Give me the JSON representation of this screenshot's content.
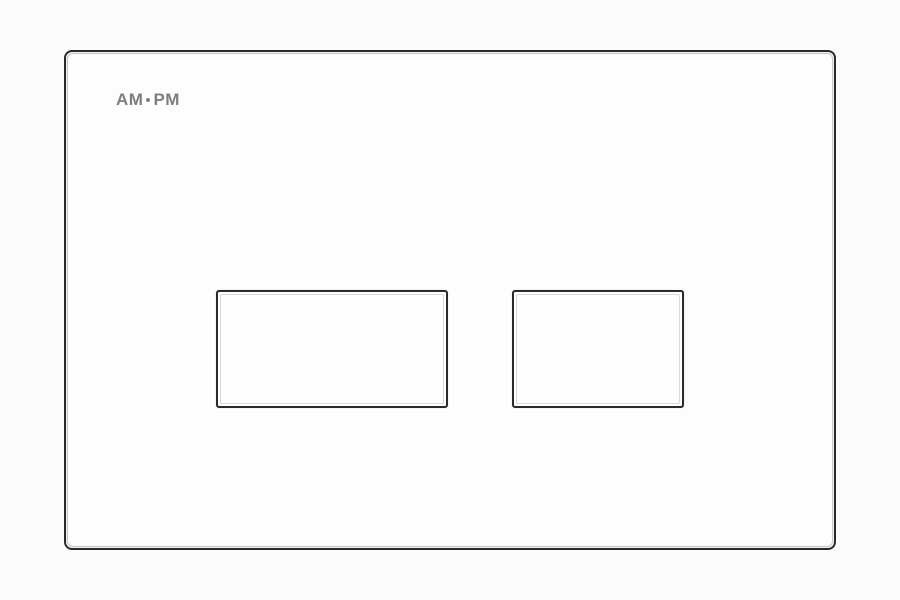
{
  "brand": {
    "part1": "AM",
    "part2": "PM"
  }
}
